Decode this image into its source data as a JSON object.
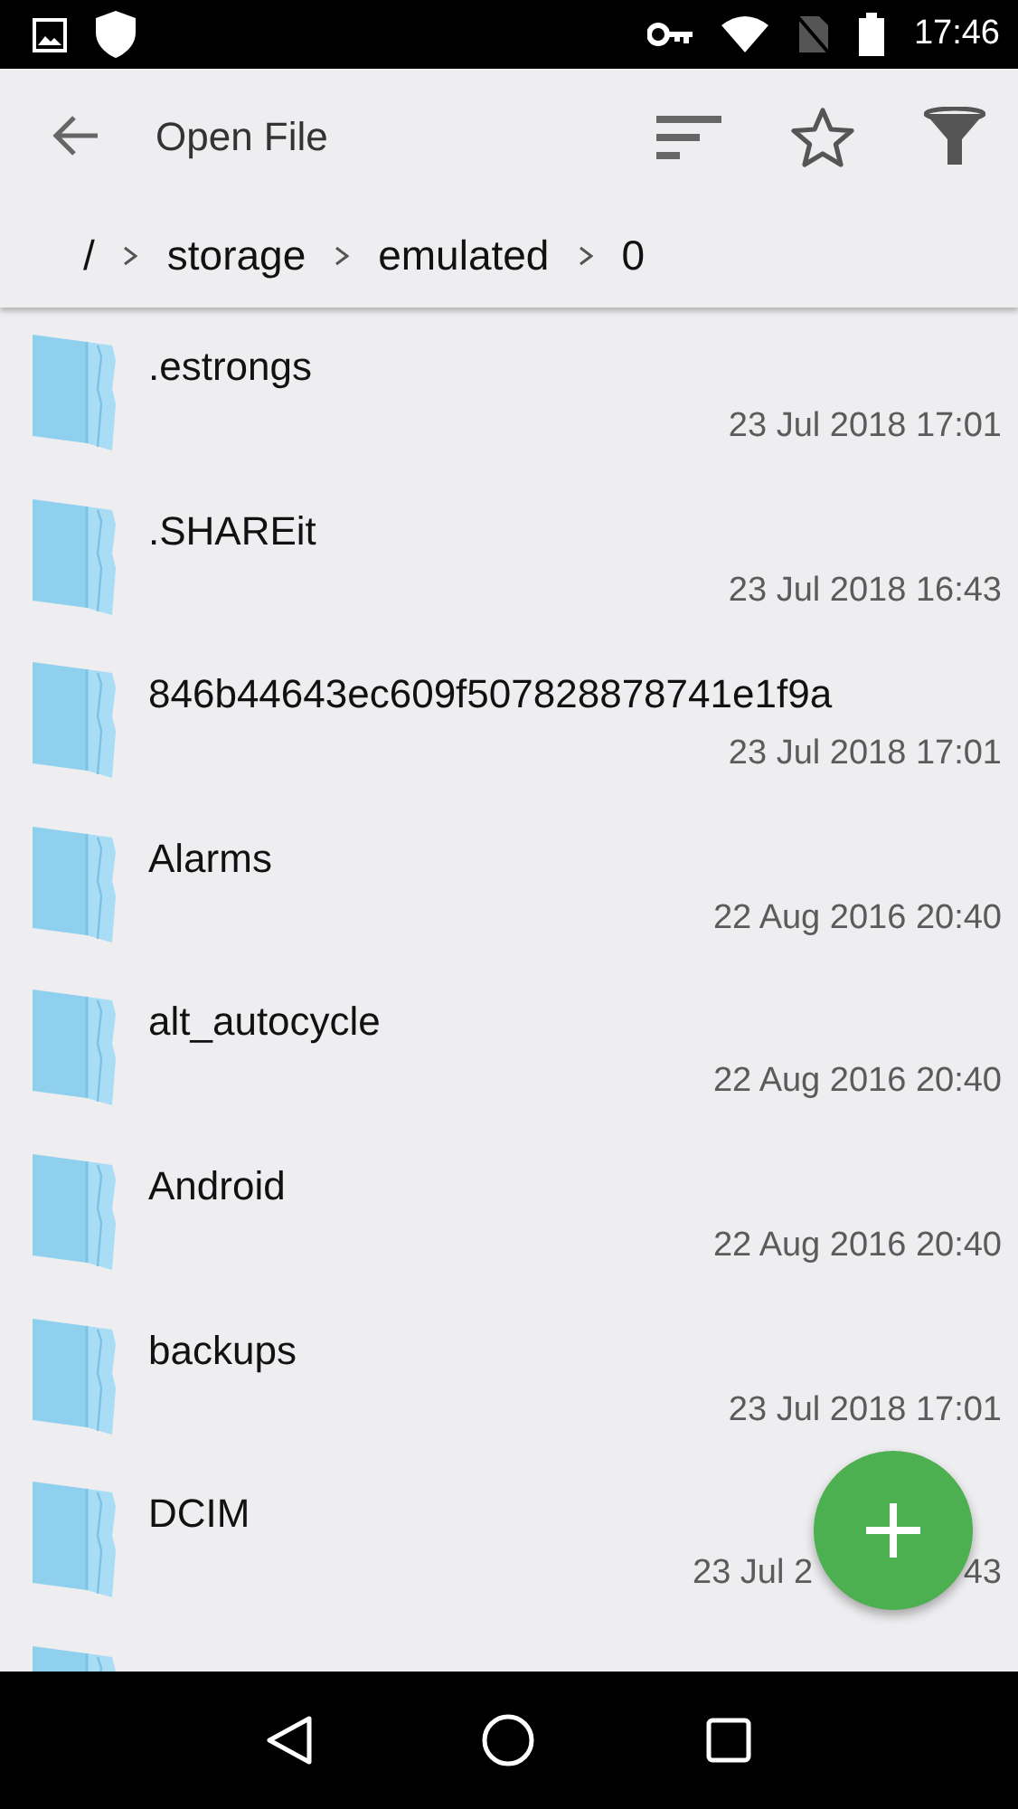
{
  "status_bar": {
    "time": "17:46"
  },
  "toolbar": {
    "title": "Open File"
  },
  "breadcrumb": [
    {
      "label": "/"
    },
    {
      "label": "storage"
    },
    {
      "label": "emulated"
    },
    {
      "label": "0"
    }
  ],
  "files": [
    {
      "name": ".estrongs",
      "date": "23 Jul 2018 17:01"
    },
    {
      "name": ".SHAREit",
      "date": "23 Jul 2018 16:43"
    },
    {
      "name": "846b44643ec609f507828878741e1f9a",
      "date": "23 Jul 2018 17:01"
    },
    {
      "name": "Alarms",
      "date": "22 Aug 2016 20:40"
    },
    {
      "name": "alt_autocycle",
      "date": "22 Aug 2016 20:40"
    },
    {
      "name": "Android",
      "date": "22 Aug 2016 20:40"
    },
    {
      "name": "backups",
      "date": "23 Jul 2018 17:01"
    },
    {
      "name": "DCIM",
      "date": "23 Jul 2",
      "date_end": "43"
    }
  ],
  "more_below": true
}
